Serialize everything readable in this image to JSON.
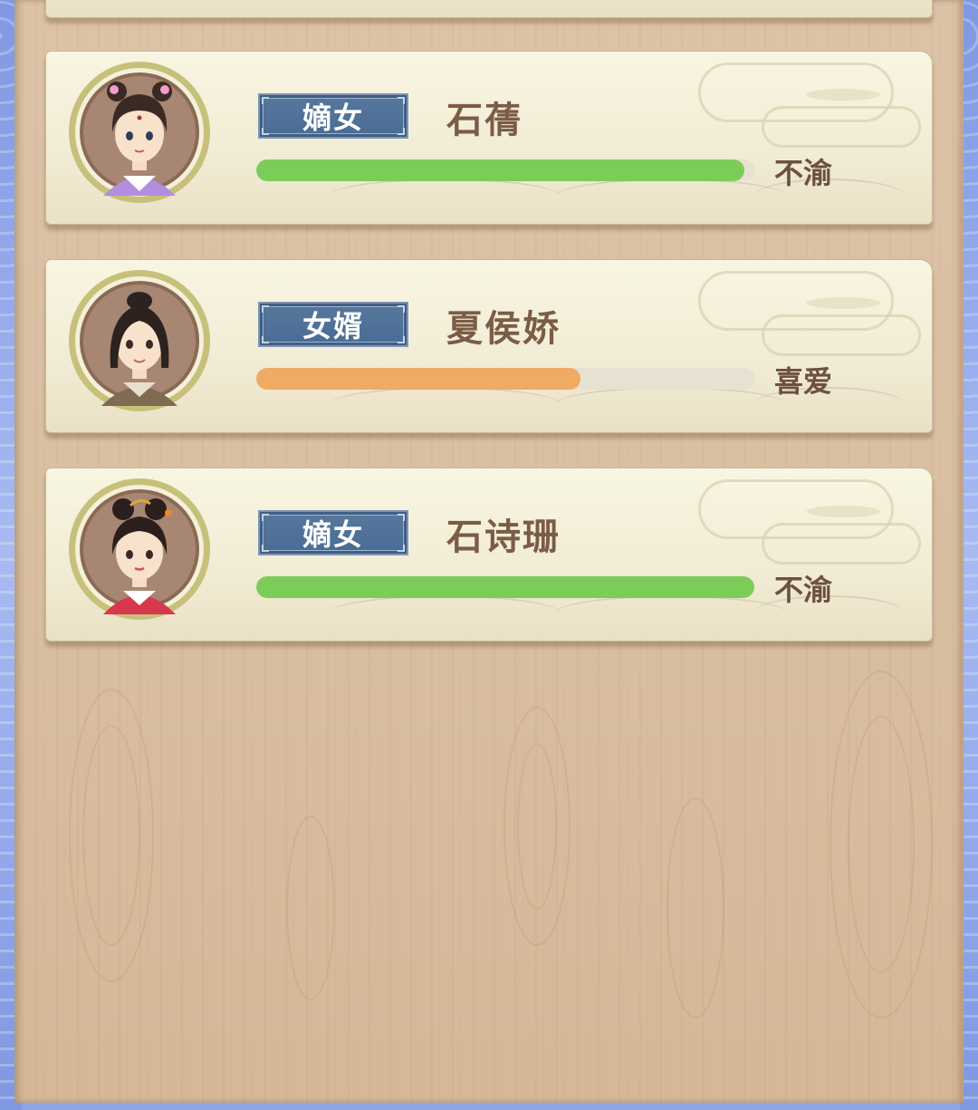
{
  "members": [
    {
      "rank": "嫡女",
      "name": "石蒨",
      "mood": "不渝",
      "affinity": 0.98,
      "bar_color": "#7ccc5a",
      "avatar": "girl-flower-hair-purple-robe"
    },
    {
      "rank": "女婿",
      "name": "夏侯娇",
      "mood": "喜爱",
      "affinity": 0.65,
      "bar_color": "#efaa64",
      "avatar": "young-man-long-hair-brown-robe"
    },
    {
      "rank": "嫡女",
      "name": "石诗珊",
      "mood": "不渝",
      "affinity": 1.0,
      "bar_color": "#7ccc5a",
      "avatar": "girl-bun-hairpin-red-robe"
    }
  ],
  "colors": {
    "badge": "#4a6b93",
    "name_text": "#7b5c46",
    "card": "#f4f0da",
    "wood": "#d9bfa2"
  }
}
